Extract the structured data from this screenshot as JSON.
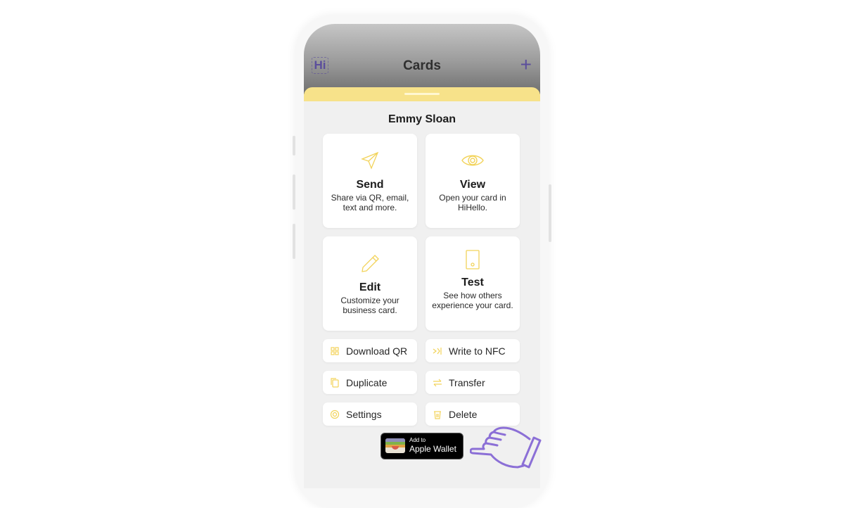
{
  "app": {
    "logo_text": "Hi",
    "title": "Cards",
    "add_icon": "plus-icon",
    "accent_color": "#5b4e9c",
    "sheet_color": "#f7e28a",
    "icon_color": "#f2d35a"
  },
  "card": {
    "owner_name": "Emmy Sloan"
  },
  "tiles": [
    {
      "icon": "send-icon",
      "title": "Send",
      "description": "Share via QR, email, text and more."
    },
    {
      "icon": "eye-icon",
      "title": "View",
      "description": "Open your card in HiHello."
    },
    {
      "icon": "pencil-icon",
      "title": "Edit",
      "description": "Customize your business card."
    },
    {
      "icon": "phone-icon",
      "title": "Test",
      "description": "See how others experience your card."
    }
  ],
  "actions": [
    {
      "icon": "qr-icon",
      "label": "Download QR"
    },
    {
      "icon": "nfc-icon",
      "label": "Write to NFC"
    },
    {
      "icon": "duplicate-icon",
      "label": "Duplicate"
    },
    {
      "icon": "transfer-icon",
      "label": "Transfer"
    },
    {
      "icon": "gear-icon",
      "label": "Settings"
    },
    {
      "icon": "trash-icon",
      "label": "Delete"
    }
  ],
  "wallet_button": {
    "line1": "Add to",
    "line2": "Apple Wallet"
  },
  "pointer": {
    "icon": "pointing-hand-icon",
    "color": "#8b6fd6"
  }
}
